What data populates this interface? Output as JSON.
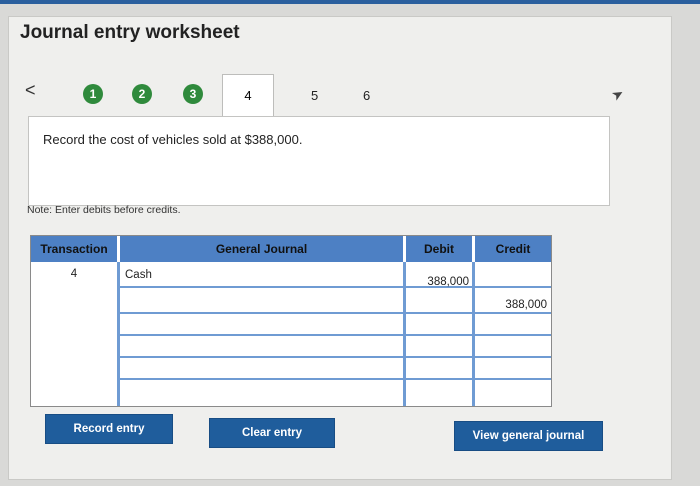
{
  "header": {
    "title": "Journal entry worksheet"
  },
  "nav": {
    "prev_symbol": "<",
    "steps": [
      {
        "label": "1",
        "state": "complete"
      },
      {
        "label": "2",
        "state": "complete"
      },
      {
        "label": "3",
        "state": "complete"
      },
      {
        "label": "4",
        "state": "active"
      },
      {
        "label": "5",
        "state": "pending"
      },
      {
        "label": "6",
        "state": "pending"
      }
    ]
  },
  "instruction": "Record the cost of vehicles sold at $388,000.",
  "note": "Note: Enter debits before credits.",
  "journal": {
    "columns": {
      "transaction": "Transaction",
      "account": "General Journal",
      "debit": "Debit",
      "credit": "Credit"
    },
    "rows": [
      {
        "transaction": "4",
        "account": "Cash",
        "debit": "388,000",
        "credit": ""
      },
      {
        "transaction": "",
        "account": "",
        "debit": "",
        "credit": "388,000"
      },
      {
        "transaction": "",
        "account": "",
        "debit": "",
        "credit": ""
      },
      {
        "transaction": "",
        "account": "",
        "debit": "",
        "credit": ""
      },
      {
        "transaction": "",
        "account": "",
        "debit": "",
        "credit": ""
      },
      {
        "transaction": "",
        "account": "",
        "debit": "",
        "credit": ""
      }
    ]
  },
  "buttons": {
    "record": "Record entry",
    "clear": "Clear entry",
    "view": "View general journal"
  },
  "colors": {
    "step_complete": "#2f8a3c",
    "header_blue": "#4d80c4",
    "button_blue": "#1f5d9c"
  }
}
